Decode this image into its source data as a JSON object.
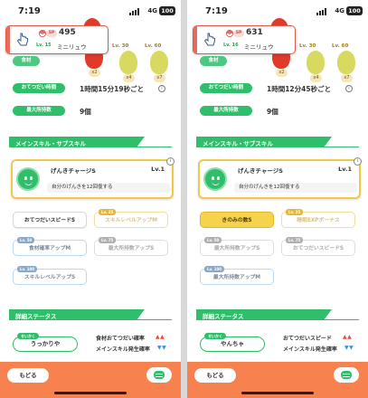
{
  "left": {
    "status": {
      "time": "7:19",
      "network": "4G",
      "battery": "100"
    },
    "items": [
      {
        "count": "x2",
        "color": "#e23a2a",
        "kind": "tomato"
      },
      {
        "count": "x4",
        "color": "#d9d860",
        "kind": "corn"
      },
      {
        "count": "x7",
        "color": "#d9d860",
        "kind": "corn"
      }
    ],
    "item_levels": [
      "Lv. 30",
      "Lv. 60"
    ],
    "popup": {
      "sp_badge": "SP",
      "sp_value": "495",
      "level": "Lv. 15",
      "name": "ミニリュウ"
    },
    "hidden_label": "食材",
    "help_interval_label": "おてつだい時間",
    "help_interval_value": "1時間15分19秒ごと",
    "max_items_label": "最大所持数",
    "max_items_value": "9個",
    "skills_section": "メインスキル・サブスキル",
    "main_skill": {
      "name": "げんきチャージS",
      "level": "Lv.1",
      "desc": "自分のげんきを12回復する"
    },
    "subskills": [
      {
        "label": "おてつだいスピードS",
        "lv": "",
        "style": "active"
      },
      {
        "label": "スキルレベルアップM",
        "lv": "Lv. 25",
        "style": "ghost-gold"
      },
      {
        "label": "食材確率アップM",
        "lv": "Lv. 50",
        "style": "blue"
      },
      {
        "label": "最大所持数アップS",
        "lv": "Lv. 75",
        "style": "dim"
      },
      {
        "label": "スキルレベルアップS",
        "lv": "Lv. 100",
        "style": "blue"
      }
    ],
    "detail_section": "詳細ステータス",
    "nature": {
      "tag": "せいかく",
      "value": "うっかりや"
    },
    "stat_up": "食材おてつだい確率",
    "stat_up_arrows": "▲▲",
    "stat_down": "メインスキル発生確率",
    "stat_down_arrows": "▼▼",
    "back": "もどる"
  },
  "right": {
    "status": {
      "time": "7:19",
      "network": "4G",
      "battery": "100"
    },
    "items": [
      {
        "count": "x2",
        "color": "#e23a2a",
        "kind": "tomato"
      },
      {
        "count": "x4",
        "color": "#d9d860",
        "kind": "corn"
      },
      {
        "count": "x7",
        "color": "#d9d860",
        "kind": "corn"
      }
    ],
    "item_levels": [
      "Lv. 30",
      "Lv. 60"
    ],
    "popup": {
      "sp_badge": "SP",
      "sp_value": "631",
      "level": "Lv. 16",
      "name": "ミニリュウ"
    },
    "hidden_label": "食材",
    "help_interval_label": "おてつだい時間",
    "help_interval_value": "1時間12分45秒ごと",
    "max_items_label": "最大所持数",
    "max_items_value": "9個",
    "skills_section": "メインスキル・サブスキル",
    "main_skill": {
      "name": "げんきチャージS",
      "level": "Lv.1",
      "desc": "自分のげんきを12回復する"
    },
    "subskills": [
      {
        "label": "きのみの数S",
        "lv": "",
        "style": "gold"
      },
      {
        "label": "睡眠EXPボーナス",
        "lv": "Lv. 25",
        "style": "ghost-gold"
      },
      {
        "label": "最大所持数アップS",
        "lv": "Lv. 50",
        "style": "dim"
      },
      {
        "label": "おてつだいスピードS",
        "lv": "Lv. 75",
        "style": "dim"
      },
      {
        "label": "最大所持数アップM",
        "lv": "Lv. 100",
        "style": "blue"
      }
    ],
    "detail_section": "詳細ステータス",
    "nature": {
      "tag": "せいかく",
      "value": "やんちゃ"
    },
    "stat_up": "おてつだいスピード",
    "stat_up_arrows": "▲▲",
    "stat_down": "メインスキル発生確率",
    "stat_down_arrows": "▼▼",
    "back": "もどる"
  },
  "colors": {
    "accent_green": "#2fbf6a",
    "popup_red": "#e05a4a",
    "bottom_orange": "#f7824f",
    "up_arrow": "#e8483a",
    "down_arrow": "#3a8ee8"
  }
}
